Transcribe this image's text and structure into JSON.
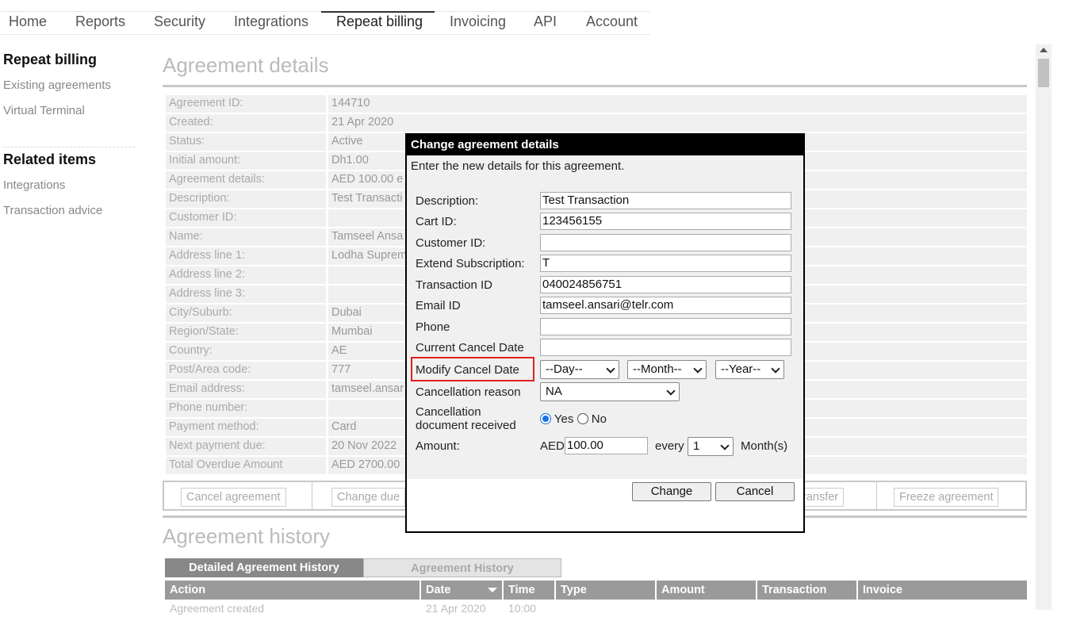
{
  "nav": {
    "tabs": [
      "Home",
      "Reports",
      "Security",
      "Integrations",
      "Repeat billing",
      "Invoicing",
      "API",
      "Account"
    ],
    "active": "Repeat billing"
  },
  "sidebar": {
    "section1_title": "Repeat billing",
    "section1_items": [
      "Existing agreements",
      "Virtual Terminal"
    ],
    "section2_title": "Related items",
    "section2_items": [
      "Integrations",
      "Transaction advice"
    ]
  },
  "main": {
    "title": "Agreement details",
    "details": [
      {
        "label": "Agreement ID:",
        "value": "144710"
      },
      {
        "label": "Created:",
        "value": "21 Apr 2020"
      },
      {
        "label": "Status:",
        "value": "Active"
      },
      {
        "label": "Initial amount:",
        "value": "Dh1.00"
      },
      {
        "label": "Agreement details:",
        "value": "AED 100.00 e"
      },
      {
        "label": "Description:",
        "value": "Test Transacti"
      },
      {
        "label": "Customer ID:",
        "value": ""
      },
      {
        "label": "Name:",
        "value": "Tamseel Ansa"
      },
      {
        "label": "Address line 1:",
        "value": "Lodha Suprem"
      },
      {
        "label": "Address line 2:",
        "value": ""
      },
      {
        "label": "Address line 3:",
        "value": ""
      },
      {
        "label": "City/Suburb:",
        "value": "Dubai"
      },
      {
        "label": "Region/State:",
        "value": "Mumbai"
      },
      {
        "label": "Country:",
        "value": "AE"
      },
      {
        "label": "Post/Area code:",
        "value": "777"
      },
      {
        "label": "Email address:",
        "value": "tamseel.ansar"
      },
      {
        "label": "Phone number:",
        "value": ""
      },
      {
        "label": "Payment method:",
        "value": "Card"
      },
      {
        "label": "Next payment due:",
        "value": "20 Nov 2022"
      },
      {
        "label": "Total Overdue Amount",
        "value": "AED 2700.00"
      }
    ],
    "actions": {
      "cancel": "Cancel agreement",
      "change_due": "Change due",
      "transfer": "ransfer",
      "freeze": "Freeze agreement"
    },
    "history_title": "Agreement history",
    "history_tabs": [
      "Detailed Agreement History",
      "Agreement History"
    ],
    "history_columns": [
      "Action",
      "Date",
      "Time",
      "Type",
      "Amount",
      "Transaction",
      "Invoice"
    ],
    "history_first_row": {
      "action": "Agreement created",
      "date": "21 Apr 2020",
      "time": "10:00"
    }
  },
  "modal": {
    "title": "Change agreement details",
    "intro": "Enter the new details for this agreement.",
    "fields": {
      "description": {
        "label": "Description:",
        "value": "Test Transaction"
      },
      "cart_id": {
        "label": "Cart ID:",
        "value": "123456155"
      },
      "customer_id": {
        "label": "Customer ID:",
        "value": ""
      },
      "extend": {
        "label": "Extend Subscription:",
        "value": "T"
      },
      "transaction_id": {
        "label": "Transaction ID",
        "value": "040024856751"
      },
      "email": {
        "label": "Email ID",
        "value": "tamseel.ansari@telr.com"
      },
      "phone": {
        "label": "Phone",
        "value": ""
      },
      "current_cancel": {
        "label": "Current Cancel Date",
        "value": ""
      }
    },
    "modify_cancel": {
      "label": "Modify Cancel Date",
      "day": "--Day--",
      "month": "--Month--",
      "year": "--Year--"
    },
    "reason": {
      "label": "Cancellation reason",
      "value": "NA"
    },
    "doc_received": {
      "label_line1": "Cancellation",
      "label_line2": "document received",
      "yes": "Yes",
      "no": "No",
      "selected": "Yes"
    },
    "amount": {
      "label": "Amount:",
      "currency": "AED",
      "value": "100.00",
      "every": "every",
      "period_count": "1",
      "unit": "Month(s)"
    },
    "buttons": {
      "change": "Change",
      "cancel": "Cancel"
    }
  },
  "colors": {
    "highlight": "#e02020",
    "radio_accent": "#1a73e8"
  }
}
